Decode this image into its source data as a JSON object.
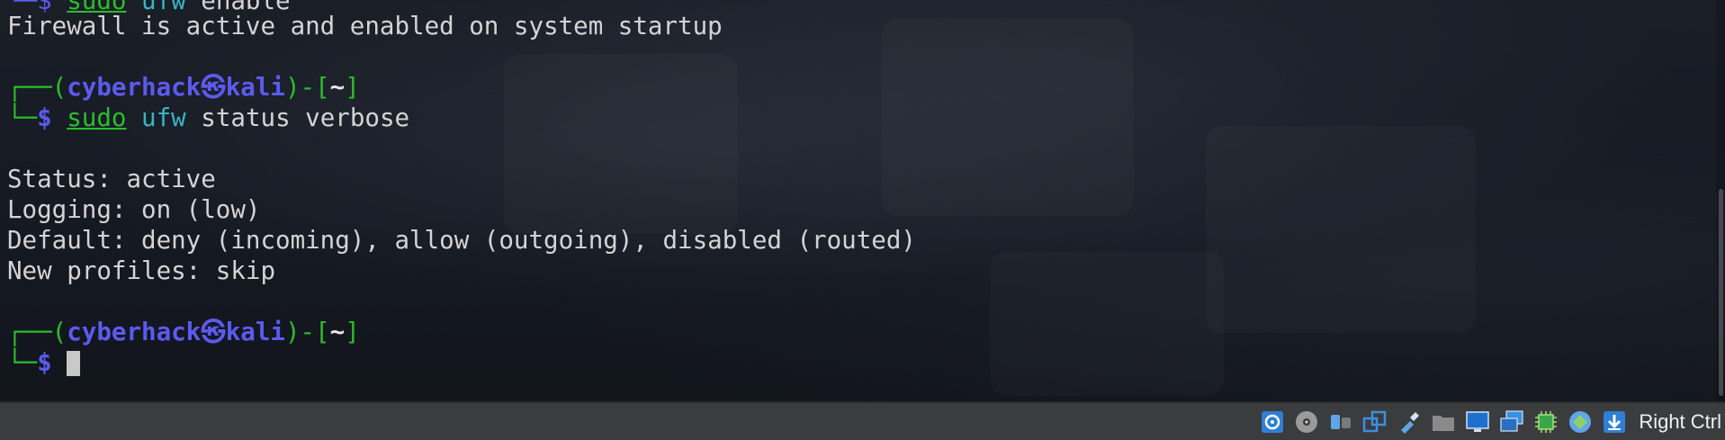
{
  "terminal": {
    "line_top_fragment": {
      "sudo": "sudo",
      "cmd": "ufw",
      "arg": "enable"
    },
    "output_firewall": "Firewall is active and enabled on system startup",
    "prompt1": {
      "open": "┌──(",
      "user": "cyberhack㉿kali",
      "mid": ")-[",
      "dir": "~",
      "close": "]"
    },
    "command1": {
      "corner": "└─",
      "dollar": "$",
      "sudo": "sudo",
      "cmd": "ufw",
      "args": "status verbose"
    },
    "status_output": [
      "Status: active",
      "Logging: on (low)",
      "Default: deny (incoming), allow (outgoing), disabled (routed)",
      "New profiles: skip"
    ],
    "prompt2": {
      "open": "┌──(",
      "user": "cyberhack㉿kali",
      "mid": ")-[",
      "dir": "~",
      "close": "]"
    },
    "command2": {
      "corner": "└─",
      "dollar": "$"
    }
  },
  "statusbar": {
    "host_key": "Right Ctrl",
    "icons": [
      "hard-disk-icon",
      "optical-drive-icon",
      "audio-icon",
      "network-icon",
      "usb-icon",
      "shared-folders-icon",
      "display-icon",
      "recording-icon",
      "cpu-icon",
      "mouse-integration-icon",
      "keyboard-capture-icon"
    ]
  }
}
